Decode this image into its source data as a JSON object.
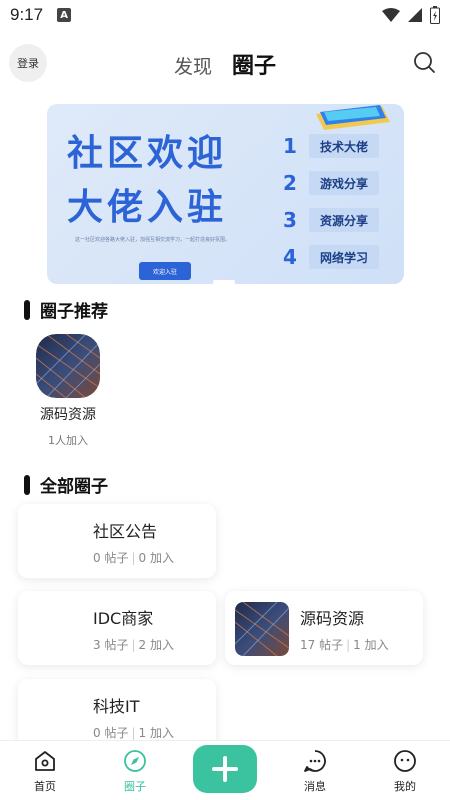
{
  "status": {
    "time": "9:17",
    "badge": "A"
  },
  "header": {
    "login_label": "登录",
    "tabs": [
      {
        "label": "发现",
        "active": false
      },
      {
        "label": "圈子",
        "active": true
      }
    ]
  },
  "banner": {
    "title_line1": "社区欢迎",
    "title_line2": "大佬入驻",
    "desc": "这一社区欢迎各路大佬入驻，加强互相交流学习，一起打造良好氛围。",
    "button_label": "欢迎入驻",
    "items": [
      {
        "num": "1",
        "label": "技术大佬"
      },
      {
        "num": "2",
        "label": "游戏分享"
      },
      {
        "num": "3",
        "label": "资源分享"
      },
      {
        "num": "4",
        "label": "网络学习"
      }
    ]
  },
  "recommend": {
    "title": "圈子推荐",
    "items": [
      {
        "name": "源码资源",
        "count": "1人加入"
      }
    ]
  },
  "all_circles": {
    "title": "全部圈子",
    "cards": [
      {
        "name": "社区公告",
        "posts": "0 帖子",
        "joins": "0 加入",
        "has_image": false
      },
      {
        "name": "IDC商家",
        "posts": "3 帖子",
        "joins": "2 加入",
        "has_image": false
      },
      {
        "name": "源码资源",
        "posts": "17 帖子",
        "joins": "1 加入",
        "has_image": true
      },
      {
        "name": "科技IT",
        "posts": "0 帖子",
        "joins": "1 加入",
        "has_image": false
      }
    ]
  },
  "bottom_nav": {
    "items": [
      {
        "label": "首页",
        "icon": "home-icon",
        "active": false
      },
      {
        "label": "圈子",
        "icon": "compass-icon",
        "active": true
      },
      {
        "label": "消息",
        "icon": "message-icon",
        "active": false
      },
      {
        "label": "我的",
        "icon": "profile-icon",
        "active": false
      }
    ],
    "add_icon": "plus-icon"
  },
  "colors": {
    "accent": "#3bc29e",
    "banner_blue": "#2c63d6"
  }
}
